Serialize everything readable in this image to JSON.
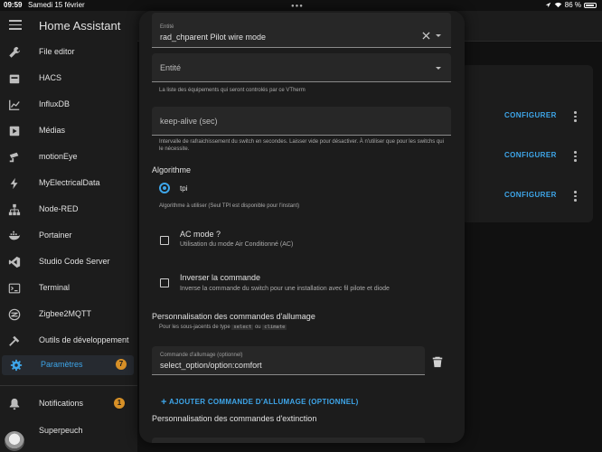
{
  "status": {
    "time": "09:59",
    "date": "Samedi 15 février",
    "battery": "86 %"
  },
  "sidebar": {
    "title": "Home Assistant",
    "items": [
      {
        "label": "File editor",
        "icon": "wrench-icon"
      },
      {
        "label": "HACS",
        "icon": "hacs-icon"
      },
      {
        "label": "InfluxDB",
        "icon": "chart-line-icon"
      },
      {
        "label": "Médias",
        "icon": "play-box-icon"
      },
      {
        "label": "motionEye",
        "icon": "cctv-icon"
      },
      {
        "label": "MyElectricalData",
        "icon": "lightning-icon"
      },
      {
        "label": "Node-RED",
        "icon": "sitemap-icon"
      },
      {
        "label": "Portainer",
        "icon": "docker-icon"
      },
      {
        "label": "Studio Code Server",
        "icon": "vscode-icon"
      },
      {
        "label": "Terminal",
        "icon": "console-icon"
      },
      {
        "label": "Zigbee2MQTT",
        "icon": "zigbee-icon"
      },
      {
        "label": "Outils de développement",
        "icon": "hammer-icon"
      },
      {
        "label": "Paramètres",
        "icon": "cog-icon",
        "badge": "7"
      }
    ],
    "notifications": {
      "label": "Notifications",
      "badge": "1"
    },
    "user": {
      "label": "Superpeuch"
    }
  },
  "background": {
    "configure_label": "CONFIGURER"
  },
  "dialog": {
    "entity1": {
      "label": "Entité",
      "value": "rad_chparent Pilot wire mode"
    },
    "entity2": {
      "placeholder": "Entité"
    },
    "entity_helper": "La liste des équipements qui seront controlés par ce VTherm",
    "keepalive": {
      "placeholder": "keep-alive (sec)"
    },
    "keepalive_helper": "Intervalle de rafraichissement du switch en secondes. Laisser vide pour désactiver. À n'utiliser que pour les switchs qui le nécessite.",
    "algo_title": "Algorithme",
    "algo_option": "tpi",
    "algo_helper": "Algorithme à utiliser (Seul TPI est disponible pour l'instant)",
    "ac_mode": {
      "title": "AC mode ?",
      "subtitle": "Utilisation du mode Air Conditionné (AC)"
    },
    "invert": {
      "title": "Inverser la commande",
      "subtitle": "Inverse la commande du switch pour une installation avec fil pilote et diode"
    },
    "turnon_title": "Personnalisation des commandes d'allumage",
    "turnon_helper_prefix": "Pour les sous-jacents de type",
    "turnon_code1": "select",
    "turnon_helper_or": "ou",
    "turnon_code2": "climate",
    "turnon_field": {
      "label": "Commande d'allumage (optionnel)",
      "value": "select_option/option:comfort"
    },
    "add_turnon": "AJOUTER COMMANDE D'ALLUMAGE (OPTIONNEL)",
    "turnoff_title": "Personnalisation des commandes d'extinction"
  },
  "colors": {
    "accent": "#3ea6ea",
    "badge": "#d79027",
    "surface": "#1c1c1c",
    "field": "#272727"
  }
}
